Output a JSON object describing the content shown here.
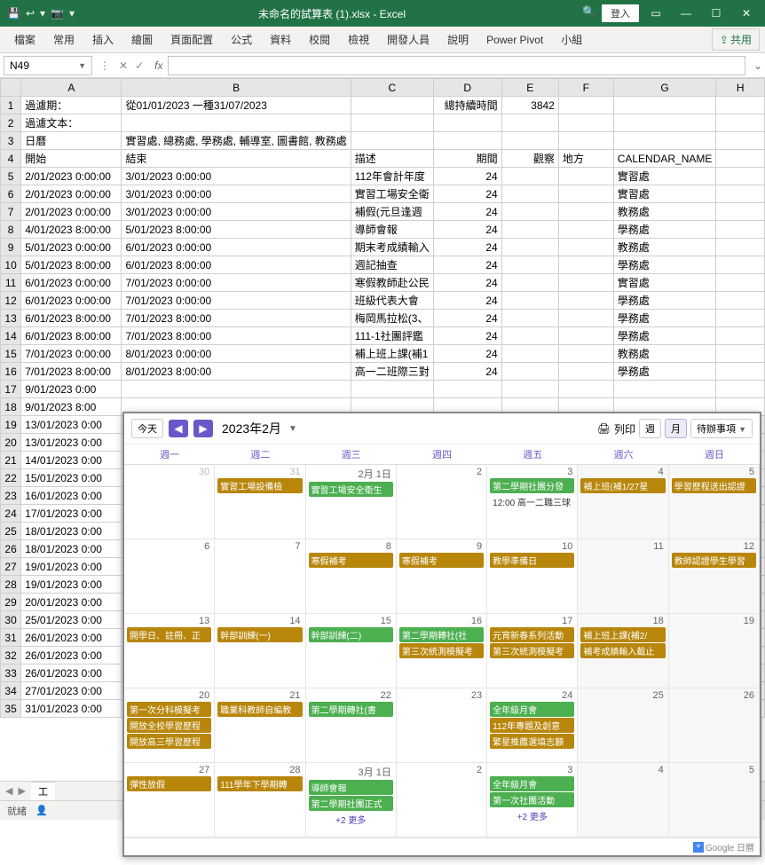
{
  "titlebar": {
    "filename": "未命名的試算表 (1).xlsx - Excel",
    "login": "登入"
  },
  "ribbon": {
    "tabs": [
      "檔案",
      "常用",
      "插入",
      "繪圖",
      "頁面配置",
      "公式",
      "資料",
      "校閱",
      "檢視",
      "開發人員",
      "說明",
      "Power Pivot",
      "小組"
    ],
    "share": "共用"
  },
  "namebox": {
    "ref": "N49",
    "fx": "fx"
  },
  "columns": [
    "A",
    "B",
    "C",
    "D",
    "E",
    "F",
    "G",
    "H"
  ],
  "rows": [
    {
      "r": "1",
      "A": "過濾期：",
      "B": "從01/01/2023 一種31/07/2023",
      "D": "總持續時間",
      "E": "3842"
    },
    {
      "r": "2",
      "A": "過濾文本："
    },
    {
      "r": "3",
      "A": "日曆",
      "B": "實習處, 總務處, 學務處, 輔導室, 圖書館, 教務處"
    },
    {
      "r": "4",
      "A": "開始",
      "B": "結束",
      "C": "描述",
      "D": "期間",
      "E": "觀察",
      "F": "地方",
      "G": "CALENDAR_NAME"
    },
    {
      "r": "5",
      "A": "2/01/2023 0:00:00",
      "B": "3/01/2023 0:00:00",
      "C": "112年會計年度",
      "D": "24",
      "G": "實習處"
    },
    {
      "r": "6",
      "A": "2/01/2023 0:00:00",
      "B": "3/01/2023 0:00:00",
      "C": "實習工場安全衛",
      "D": "24",
      "G": "實習處"
    },
    {
      "r": "7",
      "A": "2/01/2023 0:00:00",
      "B": "3/01/2023 0:00:00",
      "C": "補假(元旦逢週",
      "D": "24",
      "G": "教務處"
    },
    {
      "r": "8",
      "A": "4/01/2023 8:00:00",
      "B": "5/01/2023 8:00:00",
      "C": "導師會報",
      "D": "24",
      "G": "學務處"
    },
    {
      "r": "9",
      "A": "5/01/2023 0:00:00",
      "B": "6/01/2023 0:00:00",
      "C": "期末考成績輸入",
      "D": "24",
      "G": "教務處"
    },
    {
      "r": "10",
      "A": "5/01/2023 8:00:00",
      "B": "6/01/2023 8:00:00",
      "C": "週記抽查",
      "D": "24",
      "G": "學務處"
    },
    {
      "r": "11",
      "A": "6/01/2023 0:00:00",
      "B": "7/01/2023 0:00:00",
      "C": "寒假教師赴公民",
      "D": "24",
      "G": "實習處"
    },
    {
      "r": "12",
      "A": "6/01/2023 0:00:00",
      "B": "7/01/2023 0:00:00",
      "C": "班級代表大會",
      "D": "24",
      "G": "學務處"
    },
    {
      "r": "13",
      "A": "6/01/2023 8:00:00",
      "B": "7/01/2023 8:00:00",
      "C": "梅岡馬拉松(3、",
      "D": "24",
      "G": "學務處"
    },
    {
      "r": "14",
      "A": "6/01/2023 8:00:00",
      "B": "7/01/2023 8:00:00",
      "C": "111-1社團評鑑",
      "D": "24",
      "G": "學務處"
    },
    {
      "r": "15",
      "A": "7/01/2023 0:00:00",
      "B": "8/01/2023 0:00:00",
      "C": "補上班上課(補1",
      "D": "24",
      "G": "教務處"
    },
    {
      "r": "16",
      "A": "7/01/2023 8:00:00",
      "B": "8/01/2023 8:00:00",
      "C": "高一二班際三對",
      "D": "24",
      "G": "學務處"
    },
    {
      "r": "17",
      "A": "9/01/2023 0:00"
    },
    {
      "r": "18",
      "A": "9/01/2023 8:00"
    },
    {
      "r": "19",
      "A": "13/01/2023 0:00"
    },
    {
      "r": "20",
      "A": "13/01/2023 0:00"
    },
    {
      "r": "21",
      "A": "14/01/2023 0:00"
    },
    {
      "r": "22",
      "A": "15/01/2023 0:00"
    },
    {
      "r": "23",
      "A": "16/01/2023 0:00"
    },
    {
      "r": "24",
      "A": "17/01/2023 0:00"
    },
    {
      "r": "25",
      "A": "18/01/2023 0:00"
    },
    {
      "r": "26",
      "A": "18/01/2023 0:00"
    },
    {
      "r": "27",
      "A": "19/01/2023 0:00"
    },
    {
      "r": "28",
      "A": "19/01/2023 0:00"
    },
    {
      "r": "29",
      "A": "20/01/2023 0:00"
    },
    {
      "r": "30",
      "A": "25/01/2023 0:00"
    },
    {
      "r": "31",
      "A": "26/01/2023 0:00"
    },
    {
      "r": "32",
      "A": "26/01/2023 0:00"
    },
    {
      "r": "33",
      "A": "26/01/2023 0:00"
    },
    {
      "r": "34",
      "A": "27/01/2023 0:00"
    },
    {
      "r": "35",
      "A": "31/01/2023 0:00"
    }
  ],
  "sheet": {
    "name": "工"
  },
  "status": {
    "ready": "就緒",
    "acc": ""
  },
  "calendar": {
    "today_btn": "今天",
    "month_label": "2023年2月",
    "print": "列印",
    "view_week": "週",
    "view_month": "月",
    "todo": "待辦事項",
    "dayheaders": [
      "週一",
      "週二",
      "週三",
      "週四",
      "週五",
      "週六",
      "週日"
    ],
    "footer": "Google 日曆",
    "cells": [
      {
        "num": "30",
        "other": true,
        "events": []
      },
      {
        "num": "31",
        "other": true,
        "events": [
          {
            "cls": "brown",
            "t": "實習工場設備檢"
          }
        ]
      },
      {
        "num": "2月 1日",
        "events": [
          {
            "cls": "green",
            "t": "實習工場安全衛生"
          }
        ]
      },
      {
        "num": "2",
        "events": []
      },
      {
        "num": "3",
        "events": [
          {
            "cls": "green",
            "t": "第二學期社團分發"
          },
          {
            "cls": "text",
            "t": "12:00 高一二職三球"
          }
        ]
      },
      {
        "num": "4",
        "weekend": true,
        "events": [
          {
            "cls": "brown",
            "t": "補上班(補1/27星"
          }
        ]
      },
      {
        "num": "5",
        "weekend": true,
        "events": [
          {
            "cls": "brown",
            "t": "學習歷程送出認證"
          }
        ]
      },
      {
        "num": "6",
        "events": []
      },
      {
        "num": "7",
        "events": []
      },
      {
        "num": "8",
        "events": [
          {
            "cls": "brown",
            "t": "寒假補考"
          }
        ]
      },
      {
        "num": "9",
        "events": [
          {
            "cls": "brown",
            "t": "寒假補考"
          }
        ]
      },
      {
        "num": "10",
        "events": [
          {
            "cls": "brown",
            "t": "教學準備日"
          }
        ]
      },
      {
        "num": "11",
        "weekend": true,
        "events": []
      },
      {
        "num": "12",
        "weekend": true,
        "events": [
          {
            "cls": "brown",
            "t": "教師認證學生學習"
          }
        ]
      },
      {
        "num": "13",
        "events": [
          {
            "cls": "brown",
            "t": "開學日、註冊、正"
          }
        ]
      },
      {
        "num": "14",
        "events": [
          {
            "cls": "brown",
            "t": "幹部訓練(一)"
          }
        ]
      },
      {
        "num": "15",
        "events": [
          {
            "cls": "green",
            "t": "幹部訓練(二)"
          }
        ]
      },
      {
        "num": "16",
        "events": [
          {
            "cls": "green",
            "t": "第二學期轉社(社"
          },
          {
            "cls": "brown",
            "t": "第三次統測模擬考"
          }
        ]
      },
      {
        "num": "17",
        "events": [
          {
            "cls": "brown",
            "t": "元宵新春系列活動"
          },
          {
            "cls": "brown",
            "t": "第三次統測模擬考"
          }
        ]
      },
      {
        "num": "18",
        "weekend": true,
        "events": [
          {
            "cls": "brown",
            "t": "補上班上課(補2/"
          },
          {
            "cls": "brown",
            "t": "補考成績輸入截止"
          }
        ]
      },
      {
        "num": "19",
        "weekend": true,
        "events": []
      },
      {
        "num": "20",
        "events": [
          {
            "cls": "brown",
            "t": "第一次分科模擬考"
          },
          {
            "cls": "brown",
            "t": "開放全校學習歷程"
          },
          {
            "cls": "brown",
            "t": "開放高三學習歷程"
          }
        ]
      },
      {
        "num": "21",
        "events": [
          {
            "cls": "brown",
            "t": "職業科教師自編教"
          }
        ]
      },
      {
        "num": "22",
        "events": [
          {
            "cls": "green",
            "t": "第二學期轉社(書"
          }
        ]
      },
      {
        "num": "23",
        "events": []
      },
      {
        "num": "24",
        "events": [
          {
            "cls": "green",
            "t": "全年級月會"
          },
          {
            "cls": "brown",
            "t": "112年專題及創意"
          },
          {
            "cls": "brown",
            "t": "繁星推薦選填志願"
          }
        ]
      },
      {
        "num": "25",
        "weekend": true,
        "events": []
      },
      {
        "num": "26",
        "weekend": true,
        "events": []
      },
      {
        "num": "27",
        "events": [
          {
            "cls": "brown",
            "t": "彈性放假"
          }
        ]
      },
      {
        "num": "28",
        "events": [
          {
            "cls": "brown",
            "t": "111學年下學期轉"
          }
        ]
      },
      {
        "num": "3月 1日",
        "events": [
          {
            "cls": "green",
            "t": "導師會報"
          },
          {
            "cls": "green",
            "t": "第二學期社團正式"
          },
          {
            "cls": "more",
            "t": "+2 更多"
          }
        ]
      },
      {
        "num": "2",
        "events": []
      },
      {
        "num": "3",
        "events": [
          {
            "cls": "green",
            "t": "全年級月會"
          },
          {
            "cls": "green",
            "t": "第一次社團活動"
          },
          {
            "cls": "more",
            "t": "+2 更多"
          }
        ]
      },
      {
        "num": "4",
        "weekend": true,
        "events": []
      },
      {
        "num": "5",
        "weekend": true,
        "events": []
      }
    ]
  }
}
